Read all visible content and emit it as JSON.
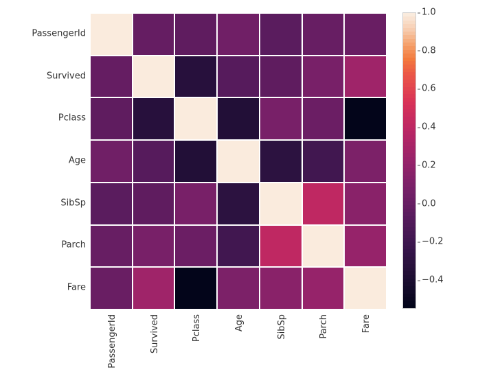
{
  "chart_data": {
    "type": "heatmap",
    "title": "",
    "xlabel": "",
    "ylabel": "",
    "categories": [
      "PassengerId",
      "Survived",
      "Pclass",
      "Age",
      "SibSp",
      "Parch",
      "Fare"
    ],
    "matrix": [
      [
        1.0,
        -0.01,
        -0.04,
        0.04,
        -0.06,
        -0.0,
        0.01
      ],
      [
        -0.01,
        1.0,
        -0.34,
        -0.08,
        -0.04,
        0.08,
        0.26
      ],
      [
        -0.04,
        -0.34,
        1.0,
        -0.37,
        0.08,
        0.02,
        -0.55
      ],
      [
        0.04,
        -0.08,
        -0.37,
        1.0,
        -0.31,
        -0.19,
        0.1
      ],
      [
        -0.06,
        -0.04,
        0.08,
        -0.31,
        1.0,
        0.41,
        0.16
      ],
      [
        -0.0,
        0.08,
        0.02,
        -0.19,
        0.41,
        1.0,
        0.22
      ],
      [
        0.01,
        0.26,
        -0.55,
        0.1,
        0.16,
        0.22,
        1.0
      ]
    ],
    "vmin": -0.55,
    "vmax": 1.0,
    "colorbar_ticks": [
      -0.4,
      -0.2,
      0.0,
      0.2,
      0.4,
      0.6,
      0.8,
      1.0
    ],
    "colormap": "rocket"
  },
  "palette": {
    "rocket_stops": [
      {
        "t": 0.0,
        "c": "#03051A"
      },
      {
        "t": 0.1,
        "c": "#1E0E33"
      },
      {
        "t": 0.2,
        "c": "#38154B"
      },
      {
        "t": 0.3,
        "c": "#551B5C"
      },
      {
        "t": 0.4,
        "c": "#762068"
      },
      {
        "t": 0.5,
        "c": "#97236A"
      },
      {
        "t": 0.6,
        "c": "#B92665"
      },
      {
        "t": 0.7,
        "c": "#D83257"
      },
      {
        "t": 0.8,
        "c": "#EC5946"
      },
      {
        "t": 0.85,
        "c": "#F37B3E"
      },
      {
        "t": 0.9,
        "c": "#F5A36F"
      },
      {
        "t": 0.95,
        "c": "#F7CDB0"
      },
      {
        "t": 1.0,
        "c": "#FAEBDD"
      }
    ]
  }
}
